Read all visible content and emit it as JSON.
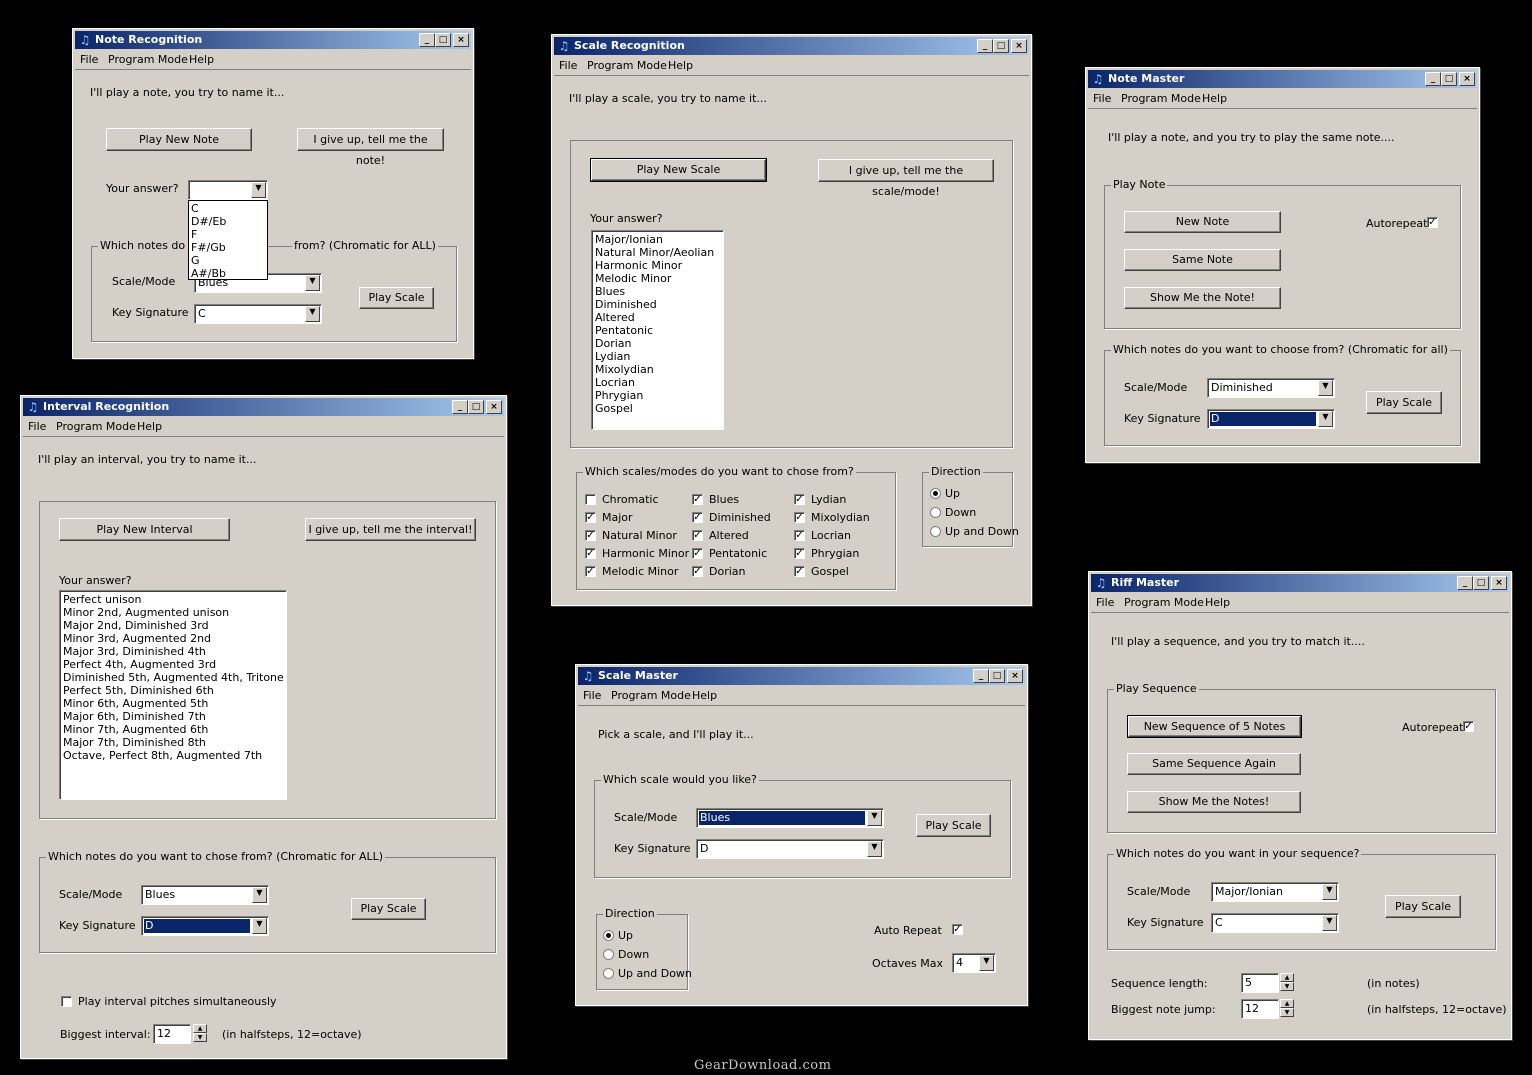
{
  "menus": {
    "file": "File",
    "mode": "Program Mode",
    "help": "Help"
  },
  "common": {
    "scale_mode": "Scale/Mode",
    "key_signature": "Key Signature",
    "play_scale": "Play Scale",
    "your_answer": "Your answer?",
    "min": "_",
    "max": "□",
    "close": "×"
  },
  "note_recognition": {
    "title": "Note Recognition",
    "intro": "I'll play a note, you try to name it...",
    "play_btn": "Play New Note",
    "giveup_btn": "I give up, tell me the note!",
    "answer_value": "",
    "dropdown": [
      "C",
      "D#/Eb",
      "F",
      "F#/Gb",
      "G",
      "A#/Bb"
    ],
    "group_label_left": "Which notes do yo",
    "group_label_right": "from?  (Chromatic for ALL)",
    "scale_value": "Blues",
    "key_value": "C"
  },
  "interval_recognition": {
    "title": "Interval Recognition",
    "intro": "I'll play an interval, you try to name it...",
    "play_btn": "Play New Interval",
    "giveup_btn": "I give up, tell me the interval!",
    "answers": [
      "Perfect unison",
      "Minor 2nd, Augmented unison",
      "Major 2nd, Diminished 3rd",
      "Minor 3rd, Augmented 2nd",
      "Major 3rd, Diminished 4th",
      "Perfect 4th, Augmented 3rd",
      "Diminished 5th, Augmented 4th, Tritone",
      "Perfect 5th, Diminished 6th",
      "Minor 6th, Augmented 5th",
      "Major 6th, Diminished 7th",
      "Minor 7th, Augmented 6th",
      "Major 7th, Diminished 8th",
      "Octave, Perfect 8th, Augmented 7th"
    ],
    "group_label": "Which notes do you want to chose from?  (Chromatic for ALL)",
    "scale_value": "Blues",
    "key_value": "D",
    "simultaneous": "Play interval pitches simultaneously",
    "biggest_label": "Biggest interval:",
    "biggest_value": "12",
    "biggest_hint": "(in halfsteps, 12=octave)"
  },
  "scale_recognition": {
    "title": "Scale Recognition",
    "intro": "I'll play a scale, you try to name it...",
    "play_btn": "Play New Scale",
    "giveup_btn": "I give up, tell me the scale/mode!",
    "answers": [
      "Major/Ionian",
      "Natural Minor/Aeolian",
      "Harmonic Minor",
      "Melodic Minor",
      "Blues",
      "Diminished",
      "Altered",
      "Pentatonic",
      "Dorian",
      "Lydian",
      "Mixolydian",
      "Locrian",
      "Phrygian",
      "Gospel"
    ],
    "choose_label": "Which scales/modes do you want to chose from?",
    "checks": [
      {
        "label": "Chromatic",
        "checked": false
      },
      {
        "label": "Major",
        "checked": true
      },
      {
        "label": "Natural Minor",
        "checked": true
      },
      {
        "label": "Harmonic Minor",
        "checked": true
      },
      {
        "label": "Melodic Minor",
        "checked": true
      },
      {
        "label": "Blues",
        "checked": true
      },
      {
        "label": "Diminished",
        "checked": true
      },
      {
        "label": "Altered",
        "checked": true
      },
      {
        "label": "Pentatonic",
        "checked": true
      },
      {
        "label": "Dorian",
        "checked": true
      },
      {
        "label": "Lydian",
        "checked": true
      },
      {
        "label": "Mixolydian",
        "checked": true
      },
      {
        "label": "Locrian",
        "checked": true
      },
      {
        "label": "Phrygian",
        "checked": true
      },
      {
        "label": "Gospel",
        "checked": true
      }
    ],
    "direction_label": "Direction",
    "dir_up": "Up",
    "dir_down": "Down",
    "dir_both": "Up and Down"
  },
  "scale_master": {
    "title": "Scale Master",
    "intro": "Pick a scale, and I'll play it...",
    "group_label": "Which scale would you like?",
    "scale_value": "Blues",
    "key_value": "D",
    "direction_label": "Direction",
    "dir_up": "Up",
    "dir_down": "Down",
    "dir_both": "Up and Down",
    "auto_repeat": "Auto Repeat",
    "octaves_label": "Octaves Max",
    "octaves_value": "4"
  },
  "note_master": {
    "title": "Note Master",
    "intro": "I'll play a note, and you try to play the same note....",
    "play_group": "Play Note",
    "new_btn": "New Note",
    "same_btn": "Same Note",
    "show_btn": "Show Me the Note!",
    "autorepeat": "Autorepeat",
    "choose_label": "Which notes do you want to choose from? (Chromatic for all)",
    "scale_value": "Diminished",
    "key_value": "D"
  },
  "riff_master": {
    "title": "Riff Master",
    "intro": "I'll play a sequence, and you try to match it....",
    "play_group": "Play Sequence",
    "new_btn": "New Sequence of 5 Notes",
    "same_btn": "Same Sequence Again",
    "show_btn": "Show Me the Notes!",
    "autorepeat": "Autorepeat",
    "choose_label": "Which notes do you want in your sequence?",
    "scale_value": "Major/Ionian",
    "key_value": "C",
    "seq_label": "Sequence length:",
    "seq_value": "5",
    "seq_hint": "(in notes)",
    "jump_label": "Biggest note jump:",
    "jump_value": "12",
    "jump_hint": "(in halfsteps, 12=octave)"
  },
  "footer": "GearDownload.com"
}
